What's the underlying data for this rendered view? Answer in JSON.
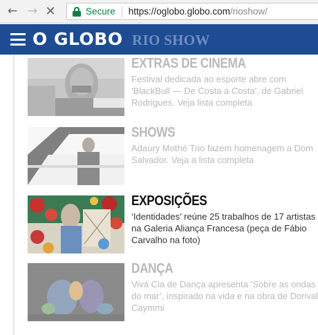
{
  "browser": {
    "secure_label": "Secure",
    "url_host": "https://oglobo.globo.com",
    "url_path": "/rioshow/",
    "icons": [
      "back-arrow-icon",
      "forward-arrow-icon",
      "stop-x-icon",
      "lock-icon"
    ]
  },
  "header": {
    "logo": "O GLOBO",
    "section": "RIO SHOW",
    "background": "#1d4c92",
    "section_color": "#6f8dc2"
  },
  "items": [
    {
      "title": "EXTRAS DE CINEMA",
      "description": "Festival dedicada ao esporte abre com 'BlackBull — De Costa a Costa', de Gabriel Rodrigues. Veja lista completa",
      "state": "faded"
    },
    {
      "title": "SHOWS",
      "description": "Adaury Mothé Trio fazem homenagem a Dom Salvador. Veja a lista completa",
      "state": "faded"
    },
    {
      "title": "EXPOSIÇÕES",
      "description": "‘Identidades’ reúne 25 trabalhos de 17 artistas na Galeria Aliança Francesa (peça de Fábio Carvalho na foto)",
      "state": "active"
    },
    {
      "title": "DANÇA",
      "description": "Vivá Cia de Dança apresenta ‘Sobre as ondas do mar’, inspirado na vida e na obra de Dorival Caymmi",
      "state": "faded"
    }
  ]
}
